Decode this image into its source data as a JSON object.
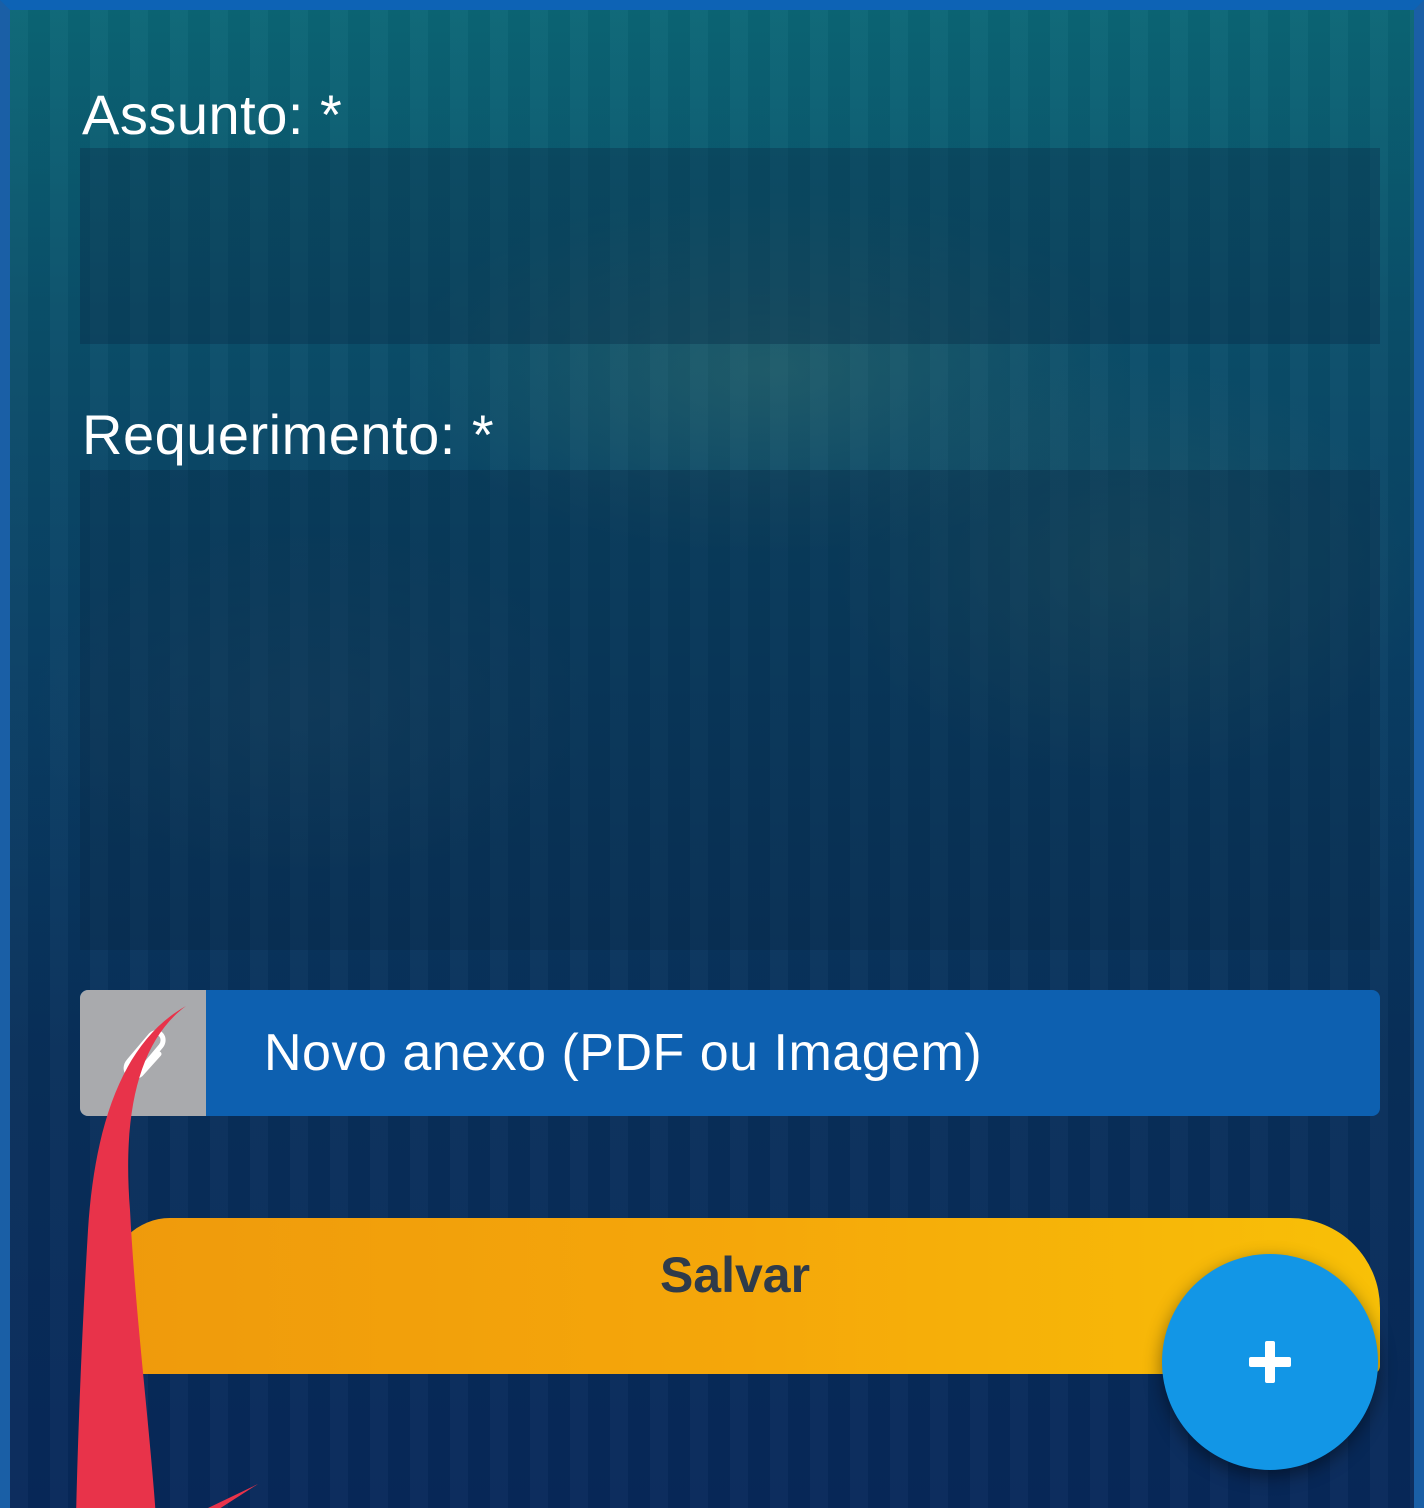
{
  "form": {
    "subject_label": "Assunto: *",
    "subject_value": "",
    "request_label": "Requerimento: *",
    "request_value": "",
    "attachment_label": "Novo anexo (PDF ou Imagem)",
    "save_label": "Salvar"
  },
  "fab": {
    "icon": "plus-icon"
  },
  "overlay": {
    "arrow_icon": "curved-arrow-annotation",
    "arrow_color": "#e8334a"
  },
  "colors": {
    "attach_bg": "#0d60b0",
    "save_bg": "#f5a70a",
    "fab_bg": "#1296e6"
  }
}
